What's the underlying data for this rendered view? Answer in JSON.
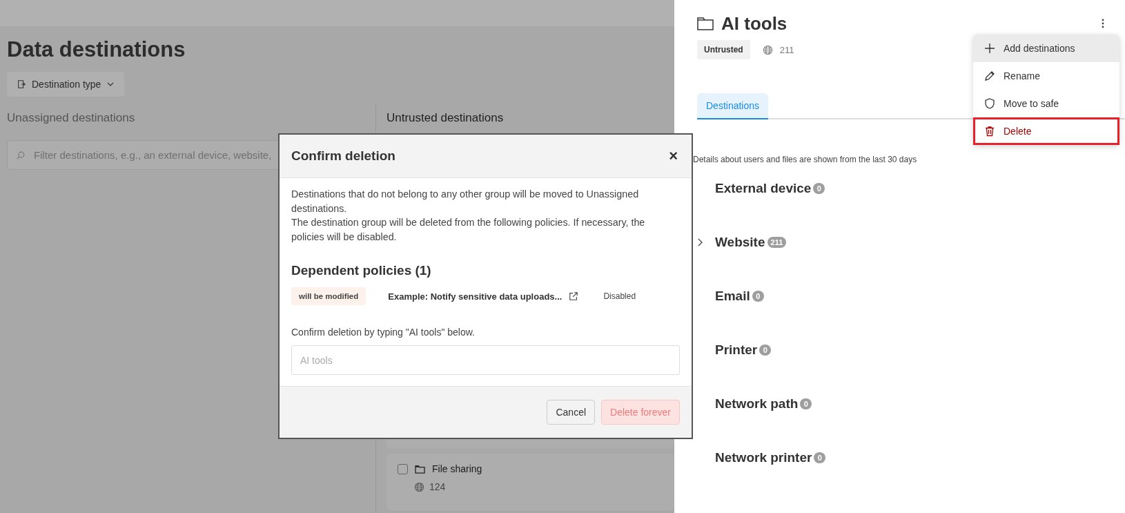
{
  "page": {
    "title": "Data destinations",
    "filter_button": "Destination type"
  },
  "unassigned": {
    "heading": "Unassigned destinations",
    "search": {
      "placeholder": "Filter destinations, e.g., an external device, website,"
    }
  },
  "untrusted": {
    "heading": "Untrusted destinations",
    "cards": [
      {
        "name": "File sharing",
        "count": "124",
        "checked": false
      }
    ]
  },
  "dialog": {
    "title": "Confirm deletion",
    "close": "×",
    "message": [
      "Destinations that do not belong to any other group will be moved to Unassigned destinations.",
      "The destination group will be deleted from the following policies. If necessary, the policies will be disabled."
    ],
    "policies_heading": "Dependent policies (1)",
    "policies": [
      {
        "tag": "will be modified",
        "name": "Example: Notify sensitive data uploads...",
        "status": "Disabled"
      }
    ],
    "prompt": "Confirm deletion by typing \"AI tools\" below.",
    "input": {
      "placeholder": "AI tools"
    },
    "buttons": [
      {
        "label": "Cancel",
        "kind": "secondary"
      },
      {
        "label": "Delete forever",
        "kind": "danger",
        "disabled": true
      }
    ]
  },
  "panel": {
    "title": "AI tools",
    "badge": "Untrusted",
    "count": "211",
    "menu": [
      {
        "label": "Add destinations",
        "kind": "add",
        "hovered": true,
        "highlighted": false
      },
      {
        "label": "Rename",
        "kind": "rename",
        "hovered": false,
        "highlighted": false
      },
      {
        "label": "Move to safe",
        "kind": "move",
        "hovered": false,
        "highlighted": false
      },
      {
        "label": "Delete",
        "kind": "delete",
        "hovered": false,
        "highlighted": true
      }
    ],
    "tabs": [
      {
        "label": "Destinations",
        "selected": true
      }
    ],
    "note": "Details about users and files are shown from the last 30 days",
    "categories": [
      {
        "name": "External device",
        "count": "0",
        "has_children": false
      },
      {
        "name": "Website",
        "count": "211",
        "has_children": true
      },
      {
        "name": "Email",
        "count": "0",
        "has_children": false
      },
      {
        "name": "Printer",
        "count": "0",
        "has_children": false
      },
      {
        "name": "Network path",
        "count": "0",
        "has_children": false
      },
      {
        "name": "Network printer",
        "count": "0",
        "has_children": false
      }
    ]
  }
}
